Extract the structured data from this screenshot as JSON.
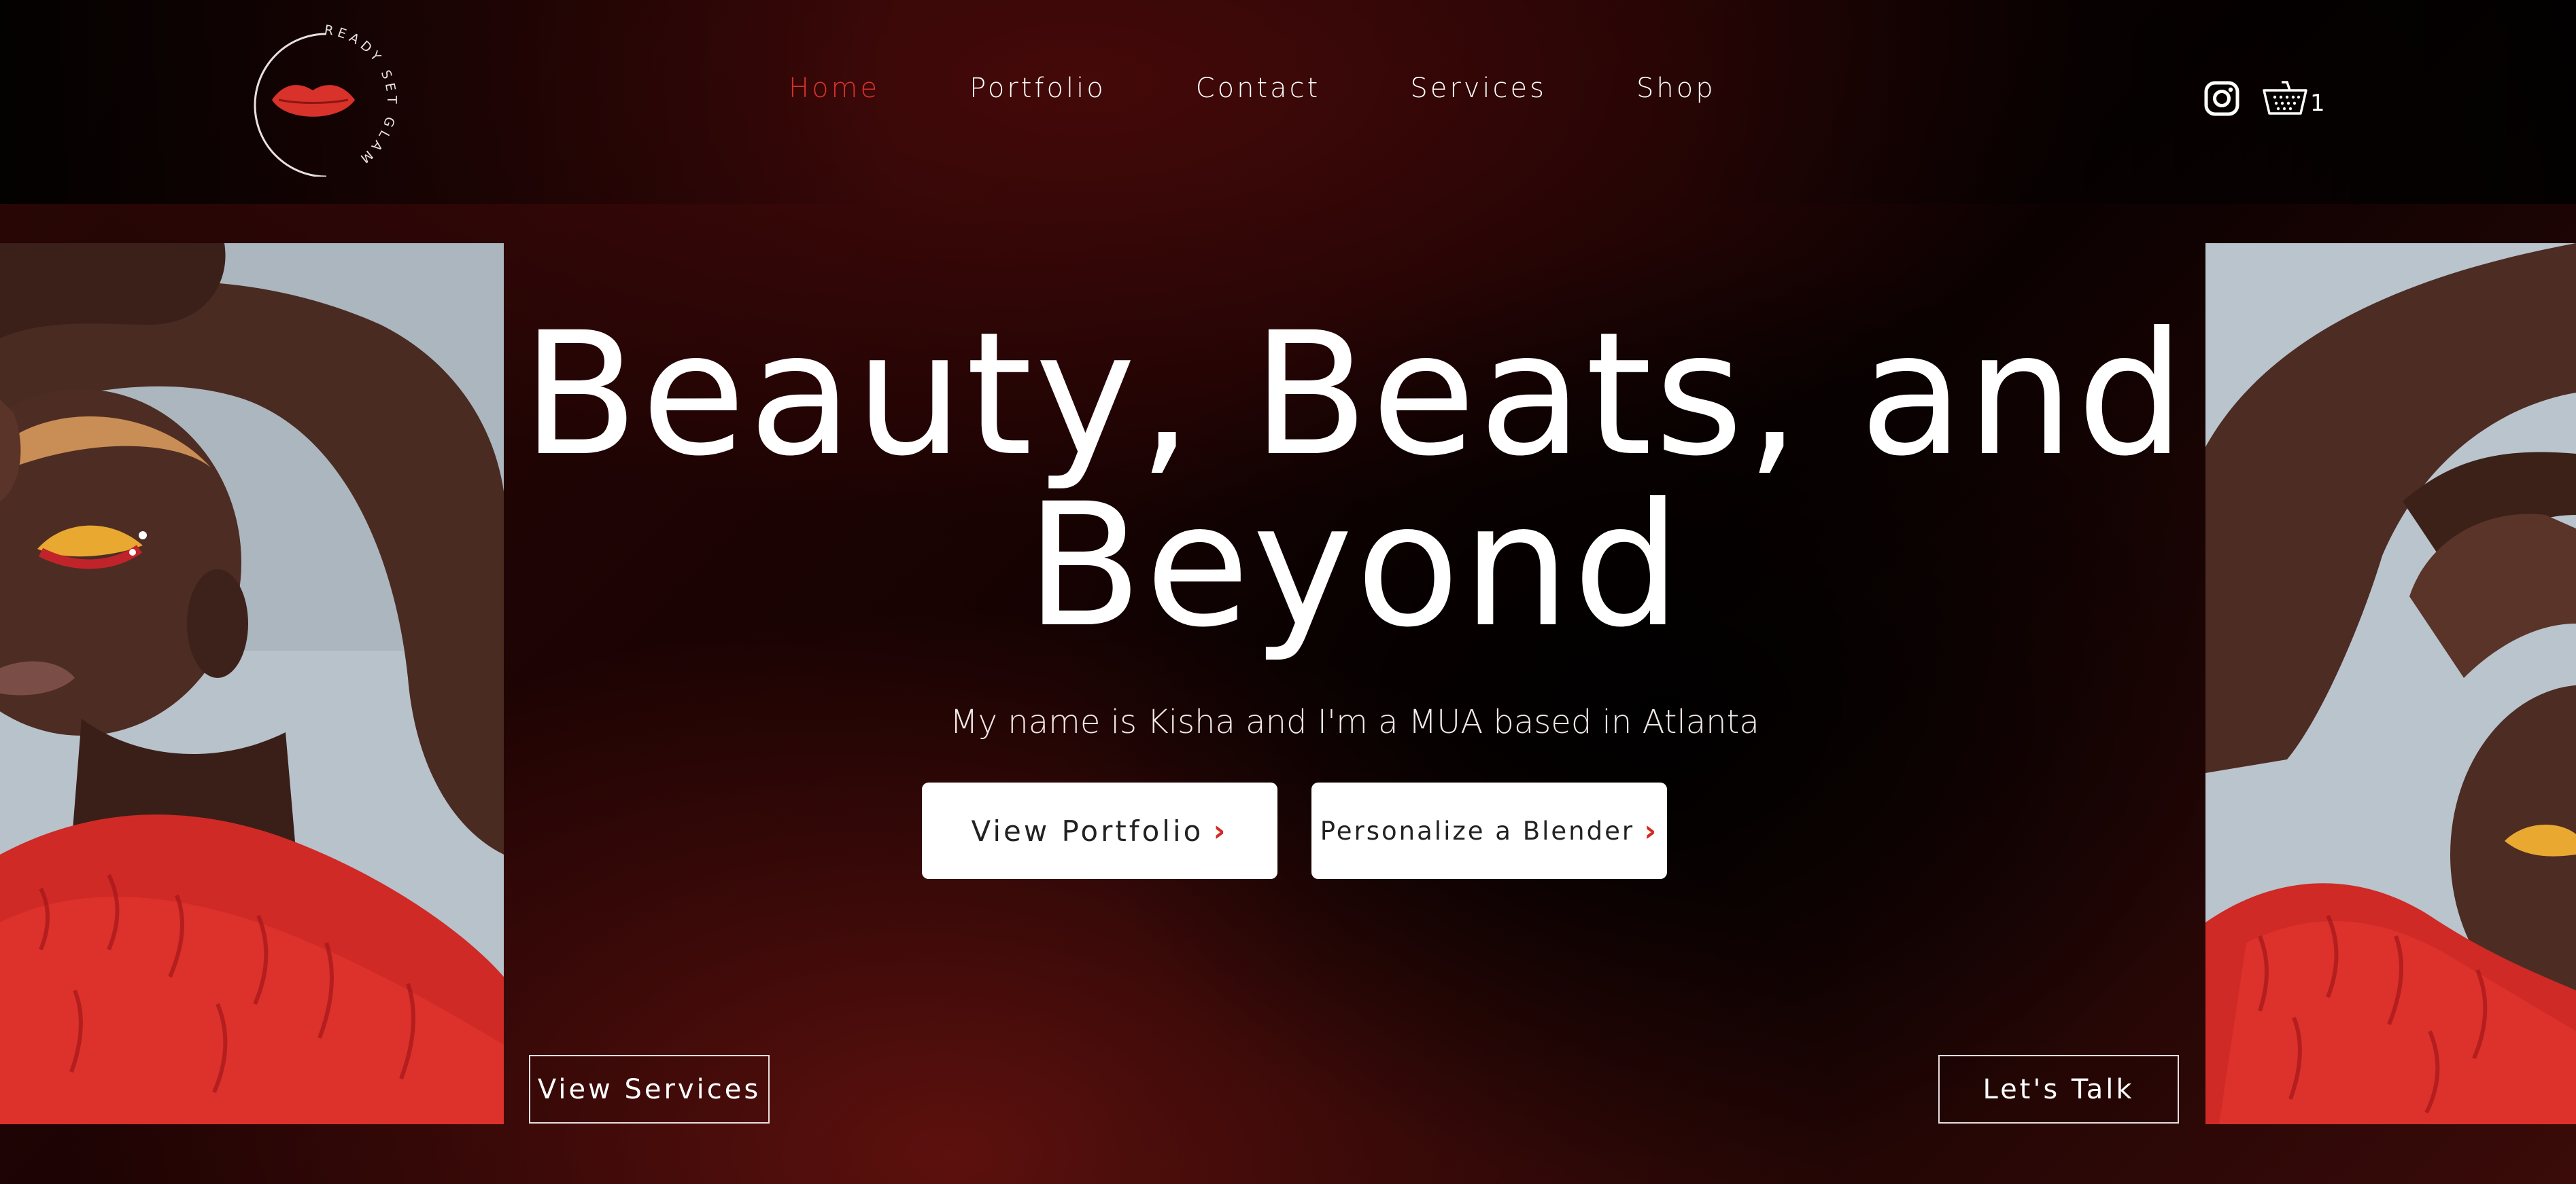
{
  "brand": {
    "logo_text": "READY SET GLAM",
    "accent_color": "#d8322a"
  },
  "nav": {
    "items": [
      {
        "label": "Home",
        "active": true
      },
      {
        "label": "Portfolio",
        "active": false
      },
      {
        "label": "Contact",
        "active": false
      },
      {
        "label": "Services",
        "active": false
      },
      {
        "label": "Shop",
        "active": false
      }
    ]
  },
  "header_actions": {
    "instagram_icon": "instagram-icon",
    "cart_icon": "basket-icon",
    "cart_count": "1"
  },
  "hero": {
    "title_line1": "Beauty, Beats, and",
    "title_line2": "Beyond",
    "subtitle": "My name is Kisha and I'm a MUA based in Atlanta",
    "primary_cta": "View Portfolio",
    "secondary_cta": "Personalize a Blender",
    "chevron": "›"
  },
  "bottom_actions": {
    "view_services": "View Services",
    "lets_talk": "Let's Talk"
  }
}
